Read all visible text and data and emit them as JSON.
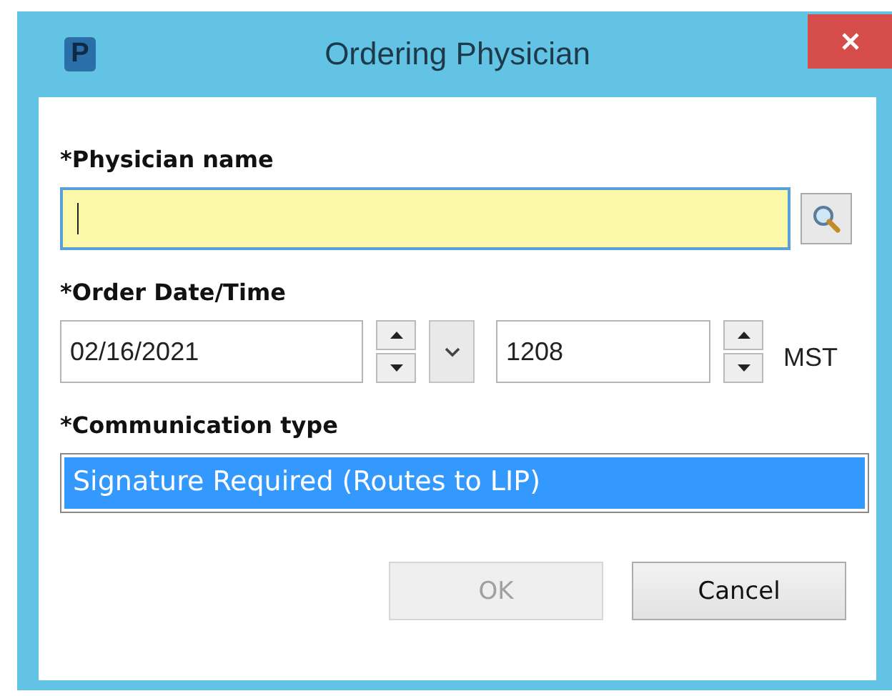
{
  "window": {
    "title": "Ordering Physician",
    "app_letter": "P"
  },
  "physician_name": {
    "label": "*Physician name"
  },
  "order_date_time": {
    "label": "*Order Date/Time",
    "date": "02/16/2021",
    "time": "1208",
    "timezone": "MST"
  },
  "communication_type": {
    "label": "*Communication type",
    "options": [
      {
        "text": "Signature Required (Routes to LIP)",
        "selected": true
      }
    ]
  },
  "buttons": [
    {
      "label": "OK",
      "disabled": true
    },
    {
      "label": "Cancel",
      "disabled": false
    }
  ]
}
